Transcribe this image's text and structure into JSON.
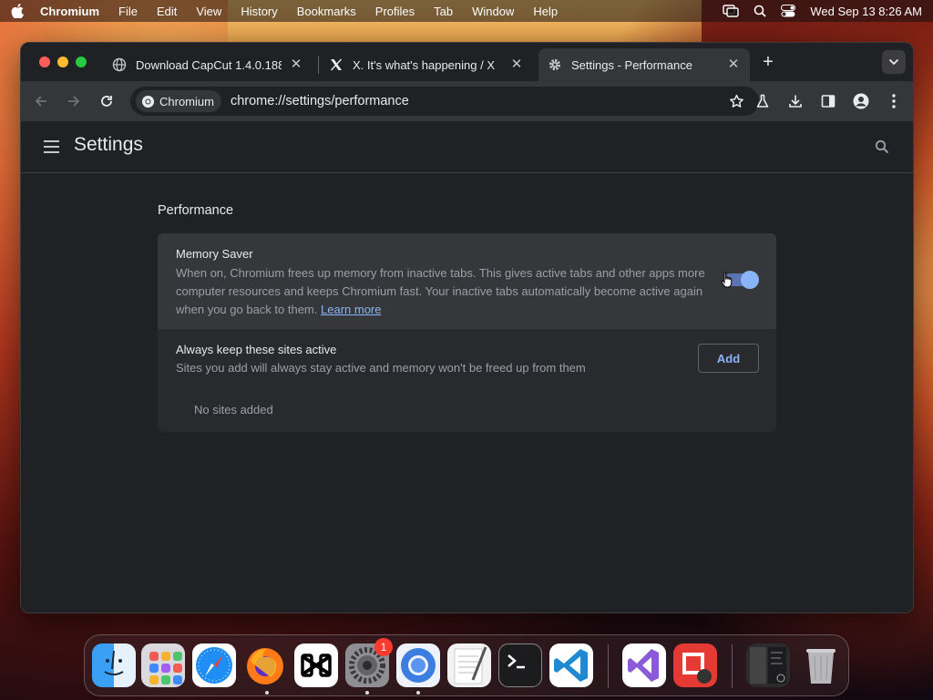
{
  "menubar": {
    "app": "Chromium",
    "items": [
      "File",
      "Edit",
      "View",
      "History",
      "Bookmarks",
      "Profiles",
      "Tab",
      "Window",
      "Help"
    ],
    "datetime": "Wed Sep 13  8:26 AM"
  },
  "tabs": [
    {
      "title": "Download CapCut 1.4.0.188",
      "icon": "globe-icon",
      "active": false
    },
    {
      "title": "X. It's what's happening / X",
      "icon": "x-logo-icon",
      "active": false
    },
    {
      "title": "Settings - Performance",
      "icon": "gear-icon",
      "active": true
    }
  ],
  "toolbar": {
    "chip_label": "Chromium",
    "url": "chrome://settings/performance"
  },
  "settings": {
    "title": "Settings",
    "section_title": "Performance",
    "memory_saver": {
      "heading": "Memory Saver",
      "description": "When on, Chromium frees up memory from inactive tabs. This gives active tabs and other apps more computer resources and keeps Chromium fast. Your inactive tabs automatically become active again when you go back to them.",
      "learn_more": "Learn more",
      "enabled": true
    },
    "keep_active": {
      "heading": "Always keep these sites active",
      "description": "Sites you add will always stay active and memory won't be freed up from them",
      "add_label": "Add",
      "empty_text": "No sites added"
    }
  },
  "dock": {
    "apps": [
      "finder-icon",
      "launchpad-icon",
      "safari-icon",
      "firefox-icon",
      "capcut-icon",
      "system-settings-icon",
      "chromium-icon",
      "textedit-icon",
      "terminal-icon",
      "vscode-icon",
      "visual-studio-icon",
      "photo-booth-icon",
      "screenshot-icon",
      "trash-icon"
    ],
    "settings_badge": "1"
  },
  "colors": {
    "accent": "#8ab4f8",
    "window_bg": "#202124",
    "toolbar_bg": "#35363a"
  }
}
